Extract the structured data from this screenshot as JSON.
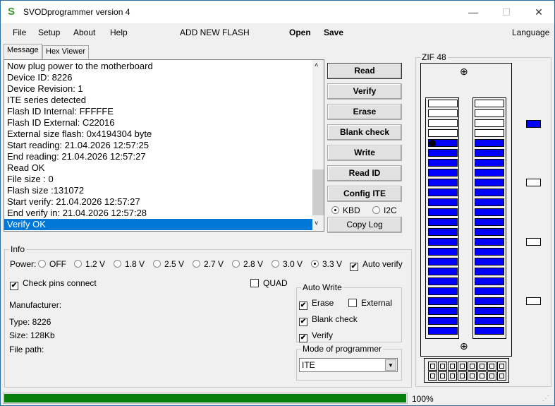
{
  "window": {
    "title": "SVODprogrammer version 4",
    "logo_text": "S",
    "controls": {
      "minimize": "—",
      "maximize": "☐",
      "close": "✕"
    }
  },
  "menu": {
    "items": [
      "File",
      "Setup",
      "About",
      "Help"
    ],
    "add_flash": "ADD NEW FLASH",
    "open": "Open",
    "save": "Save",
    "language": "Language"
  },
  "tabs": [
    "Message",
    "Hex Viewer"
  ],
  "log": [
    "Now plug power to the motherboard",
    "Device ID: 8226",
    "Device Revision: 1",
    "ITE series detected",
    "Flash ID Internal: FFFFFE",
    "Flash ID External: C22016",
    "External size flash: 0x4194304 byte",
    "Start reading: 21.04.2026 12:57:25",
    "End reading: 21.04.2026 12:57:27",
    "Read OK",
    "File size : 0",
    "Flash size :131072",
    "Start verify: 21.04.2026 12:57:27",
    "End verify in: 21.04.2026 12:57:28",
    "Verify OK"
  ],
  "log_selected_index": 14,
  "buttons": [
    "Read",
    "Verify",
    "Erase",
    "Blank check",
    "Write",
    "Read ID",
    "Config ITE"
  ],
  "interface": {
    "options": [
      "KBD",
      "I2C"
    ],
    "selected": "KBD"
  },
  "copy_log": "Copy Log",
  "info": {
    "legend": "Info",
    "power_label": "Power:",
    "power_options": [
      "OFF",
      "1.2 V",
      "1.8 V",
      "2.5 V",
      "2.7 V",
      "2.8 V",
      "3.0 V",
      "3.3 V"
    ],
    "power_selected": "3.3 V",
    "auto_verify": {
      "label": "Auto verify",
      "checked": true
    },
    "check_pins": {
      "label": "Check pins connect",
      "checked": true
    },
    "quad": {
      "label": "QUAD",
      "checked": false
    },
    "manufacturer": "Manufacturer:",
    "type": "Type: 8226",
    "size": "Size: 128Kb",
    "file_path": "File path:",
    "auto_write": {
      "legend": "Auto Write",
      "erase": {
        "label": "Erase",
        "checked": true
      },
      "external": {
        "label": "External",
        "checked": false
      },
      "blank_check": {
        "label": "Blank check",
        "checked": true
      },
      "verify": {
        "label": "Verify",
        "checked": true
      }
    },
    "mode": {
      "legend": "Mode of programmer",
      "value": "ITE"
    }
  },
  "zif": {
    "legend": "ZIF 48",
    "pins_per_side": 24,
    "empty_top_rows": 4,
    "pin_active_color": "#0000ff",
    "indicators": [
      true,
      false,
      false,
      false
    ]
  },
  "progress": {
    "value": 100,
    "label": "100%",
    "color": "#06800a"
  }
}
